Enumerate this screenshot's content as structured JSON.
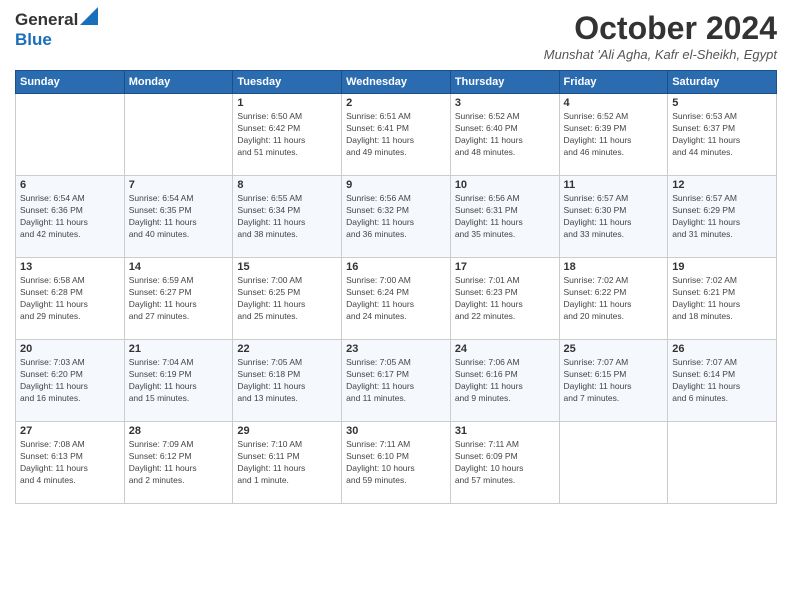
{
  "header": {
    "logo_line1": "General",
    "logo_line2": "Blue",
    "month": "October 2024",
    "location": "Munshat 'Ali Agha, Kafr el-Sheikh, Egypt"
  },
  "days_of_week": [
    "Sunday",
    "Monday",
    "Tuesday",
    "Wednesday",
    "Thursday",
    "Friday",
    "Saturday"
  ],
  "weeks": [
    [
      {
        "num": "",
        "info": ""
      },
      {
        "num": "",
        "info": ""
      },
      {
        "num": "1",
        "info": "Sunrise: 6:50 AM\nSunset: 6:42 PM\nDaylight: 11 hours\nand 51 minutes."
      },
      {
        "num": "2",
        "info": "Sunrise: 6:51 AM\nSunset: 6:41 PM\nDaylight: 11 hours\nand 49 minutes."
      },
      {
        "num": "3",
        "info": "Sunrise: 6:52 AM\nSunset: 6:40 PM\nDaylight: 11 hours\nand 48 minutes."
      },
      {
        "num": "4",
        "info": "Sunrise: 6:52 AM\nSunset: 6:39 PM\nDaylight: 11 hours\nand 46 minutes."
      },
      {
        "num": "5",
        "info": "Sunrise: 6:53 AM\nSunset: 6:37 PM\nDaylight: 11 hours\nand 44 minutes."
      }
    ],
    [
      {
        "num": "6",
        "info": "Sunrise: 6:54 AM\nSunset: 6:36 PM\nDaylight: 11 hours\nand 42 minutes."
      },
      {
        "num": "7",
        "info": "Sunrise: 6:54 AM\nSunset: 6:35 PM\nDaylight: 11 hours\nand 40 minutes."
      },
      {
        "num": "8",
        "info": "Sunrise: 6:55 AM\nSunset: 6:34 PM\nDaylight: 11 hours\nand 38 minutes."
      },
      {
        "num": "9",
        "info": "Sunrise: 6:56 AM\nSunset: 6:32 PM\nDaylight: 11 hours\nand 36 minutes."
      },
      {
        "num": "10",
        "info": "Sunrise: 6:56 AM\nSunset: 6:31 PM\nDaylight: 11 hours\nand 35 minutes."
      },
      {
        "num": "11",
        "info": "Sunrise: 6:57 AM\nSunset: 6:30 PM\nDaylight: 11 hours\nand 33 minutes."
      },
      {
        "num": "12",
        "info": "Sunrise: 6:57 AM\nSunset: 6:29 PM\nDaylight: 11 hours\nand 31 minutes."
      }
    ],
    [
      {
        "num": "13",
        "info": "Sunrise: 6:58 AM\nSunset: 6:28 PM\nDaylight: 11 hours\nand 29 minutes."
      },
      {
        "num": "14",
        "info": "Sunrise: 6:59 AM\nSunset: 6:27 PM\nDaylight: 11 hours\nand 27 minutes."
      },
      {
        "num": "15",
        "info": "Sunrise: 7:00 AM\nSunset: 6:25 PM\nDaylight: 11 hours\nand 25 minutes."
      },
      {
        "num": "16",
        "info": "Sunrise: 7:00 AM\nSunset: 6:24 PM\nDaylight: 11 hours\nand 24 minutes."
      },
      {
        "num": "17",
        "info": "Sunrise: 7:01 AM\nSunset: 6:23 PM\nDaylight: 11 hours\nand 22 minutes."
      },
      {
        "num": "18",
        "info": "Sunrise: 7:02 AM\nSunset: 6:22 PM\nDaylight: 11 hours\nand 20 minutes."
      },
      {
        "num": "19",
        "info": "Sunrise: 7:02 AM\nSunset: 6:21 PM\nDaylight: 11 hours\nand 18 minutes."
      }
    ],
    [
      {
        "num": "20",
        "info": "Sunrise: 7:03 AM\nSunset: 6:20 PM\nDaylight: 11 hours\nand 16 minutes."
      },
      {
        "num": "21",
        "info": "Sunrise: 7:04 AM\nSunset: 6:19 PM\nDaylight: 11 hours\nand 15 minutes."
      },
      {
        "num": "22",
        "info": "Sunrise: 7:05 AM\nSunset: 6:18 PM\nDaylight: 11 hours\nand 13 minutes."
      },
      {
        "num": "23",
        "info": "Sunrise: 7:05 AM\nSunset: 6:17 PM\nDaylight: 11 hours\nand 11 minutes."
      },
      {
        "num": "24",
        "info": "Sunrise: 7:06 AM\nSunset: 6:16 PM\nDaylight: 11 hours\nand 9 minutes."
      },
      {
        "num": "25",
        "info": "Sunrise: 7:07 AM\nSunset: 6:15 PM\nDaylight: 11 hours\nand 7 minutes."
      },
      {
        "num": "26",
        "info": "Sunrise: 7:07 AM\nSunset: 6:14 PM\nDaylight: 11 hours\nand 6 minutes."
      }
    ],
    [
      {
        "num": "27",
        "info": "Sunrise: 7:08 AM\nSunset: 6:13 PM\nDaylight: 11 hours\nand 4 minutes."
      },
      {
        "num": "28",
        "info": "Sunrise: 7:09 AM\nSunset: 6:12 PM\nDaylight: 11 hours\nand 2 minutes."
      },
      {
        "num": "29",
        "info": "Sunrise: 7:10 AM\nSunset: 6:11 PM\nDaylight: 11 hours\nand 1 minute."
      },
      {
        "num": "30",
        "info": "Sunrise: 7:11 AM\nSunset: 6:10 PM\nDaylight: 10 hours\nand 59 minutes."
      },
      {
        "num": "31",
        "info": "Sunrise: 7:11 AM\nSunset: 6:09 PM\nDaylight: 10 hours\nand 57 minutes."
      },
      {
        "num": "",
        "info": ""
      },
      {
        "num": "",
        "info": ""
      }
    ]
  ]
}
